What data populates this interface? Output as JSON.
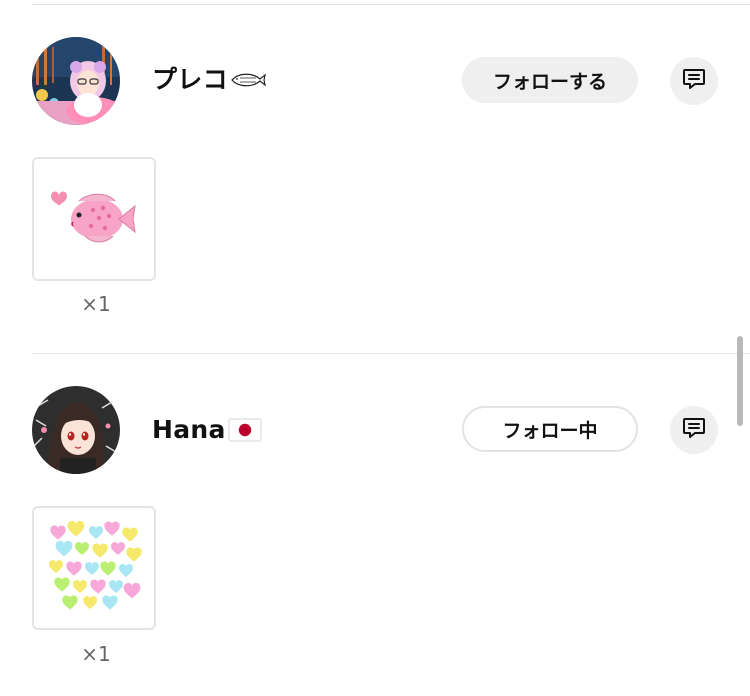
{
  "users": [
    {
      "name": "プレコ",
      "follow_label": "フォローする",
      "follow_state": "not-following",
      "gift_icon": "pink-fish-sticker",
      "gift_count": "×1"
    },
    {
      "name": "Hana",
      "follow_label": "フォロー中",
      "follow_state": "following",
      "gift_icon": "pastel-hearts-sticker",
      "gift_count": "×1"
    }
  ],
  "icons": {
    "message": "message-icon",
    "name_badge_1": "fish-icon",
    "name_badge_2": "japan-flag-icon"
  },
  "colors": {
    "button_bg": "#efefef",
    "divider": "#e6e6e6",
    "count_text": "#666666",
    "flag_red": "#bc002d"
  }
}
